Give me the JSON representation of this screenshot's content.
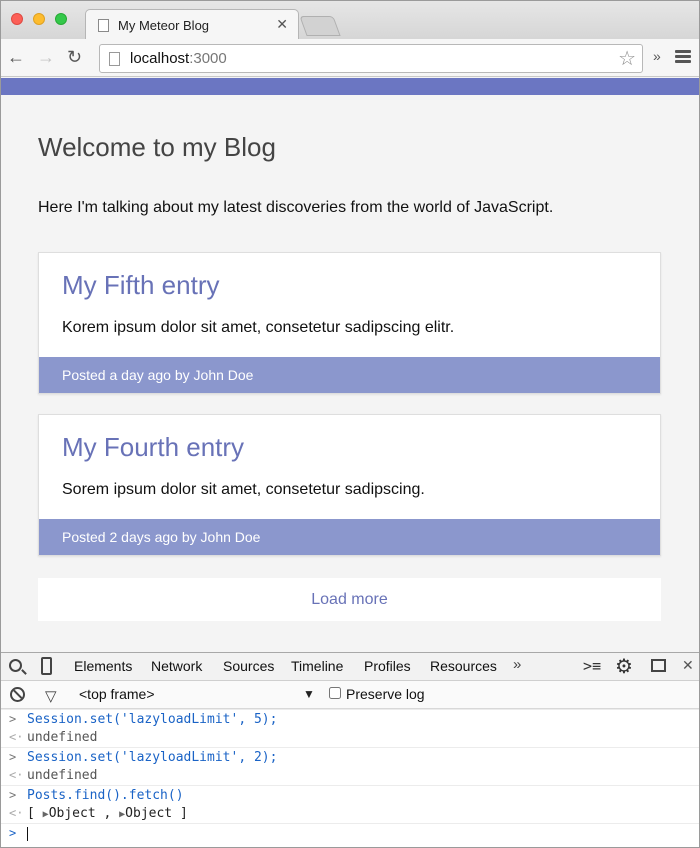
{
  "browser": {
    "tab_title": "My Meteor Blog",
    "tab_close": "✕",
    "url_host": "localhost",
    "url_port": ":3000",
    "extensions_more": "»"
  },
  "page": {
    "title": "Welcome to my Blog",
    "intro": "Here I'm talking about my latest discoveries from the world of JavaScript.",
    "posts": [
      {
        "title": "My Fifth entry",
        "text": "Korem ipsum dolor sit amet, consetetur sadipscing elitr.",
        "meta": "Posted a day ago by John Doe"
      },
      {
        "title": "My Fourth entry",
        "text": "Sorem ipsum dolor sit amet, consetetur sadipscing.",
        "meta": "Posted 2 days ago by John Doe"
      }
    ],
    "load_more": "Load more"
  },
  "devtools": {
    "tabs": [
      "Elements",
      "Network",
      "Sources",
      "Timeline",
      "Profiles",
      "Resources"
    ],
    "more": "»",
    "frame": "<top frame>",
    "preserve_log": "Preserve log",
    "console": [
      {
        "kind": "input",
        "text": "Session.set('lazyloadLimit', 5);"
      },
      {
        "kind": "output",
        "text": "undefined"
      },
      {
        "kind": "input",
        "text": "Session.set('lazyloadLimit', 2);"
      },
      {
        "kind": "output",
        "text": "undefined"
      },
      {
        "kind": "input",
        "text": "Posts.find().fetch()"
      },
      {
        "kind": "objects",
        "open": "[",
        "items": [
          "Object",
          "Object"
        ],
        "close": "]"
      }
    ]
  },
  "colors": {
    "accent": "#6b76c2",
    "post_title": "#6872b7",
    "post_footer": "#8b97cd",
    "console_input": "#1a63c6"
  }
}
